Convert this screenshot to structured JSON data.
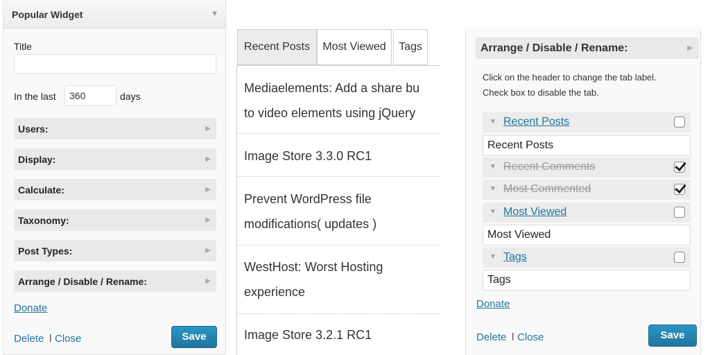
{
  "left": {
    "header_title": "Popular Widget",
    "title_label": "Title",
    "title_value": "",
    "in_the_last_label": "In the last",
    "days_value": "360",
    "days_label": "days",
    "sections": [
      "Users:",
      "Display:",
      "Calculate:",
      "Taxonomy:",
      "Post Types:",
      "Arrange / Disable / Rename:"
    ],
    "donate": "Donate",
    "delete": "Delete",
    "separator": "l",
    "close": "Close",
    "save": "Save"
  },
  "middle": {
    "tabs": [
      "Recent Posts",
      "Most Viewed",
      "Tags"
    ],
    "active_tab": "Recent Posts",
    "posts": [
      {
        "line1": "Mediaelements: Add a share bu",
        "line2": "to video elements using jQuery"
      },
      {
        "line1": "Image Store 3.3.0 RC1",
        "line2": ""
      },
      {
        "line1": "Prevent WordPress file",
        "line2": "modifications( updates )"
      },
      {
        "line1": "WestHost: Worst Hosting",
        "line2": "experience"
      },
      {
        "line1": "Image Store 3.2.1 RC1",
        "line2": ""
      }
    ]
  },
  "right": {
    "header": "Arrange / Disable / Rename:",
    "help1": "Click on the header to change the tab label.",
    "help2": "Check box to disable the tab.",
    "rows": [
      {
        "label": "Recent Posts",
        "disabled": false,
        "rename": "Recent Posts"
      },
      {
        "label": "Recent Comments",
        "disabled": true,
        "rename": ""
      },
      {
        "label": "Most Commented",
        "disabled": true,
        "rename": ""
      },
      {
        "label": "Most Viewed",
        "disabled": false,
        "rename": "Most Viewed"
      },
      {
        "label": "Tags",
        "disabled": false,
        "rename": "Tags"
      }
    ],
    "donate": "Donate",
    "delete": "Delete",
    "separator": "l",
    "close": "Close",
    "save": "Save"
  },
  "icons": {
    "collapse": "triangle-down-icon",
    "expand": "triangle-right-icon",
    "check": "checkmark-icon"
  }
}
